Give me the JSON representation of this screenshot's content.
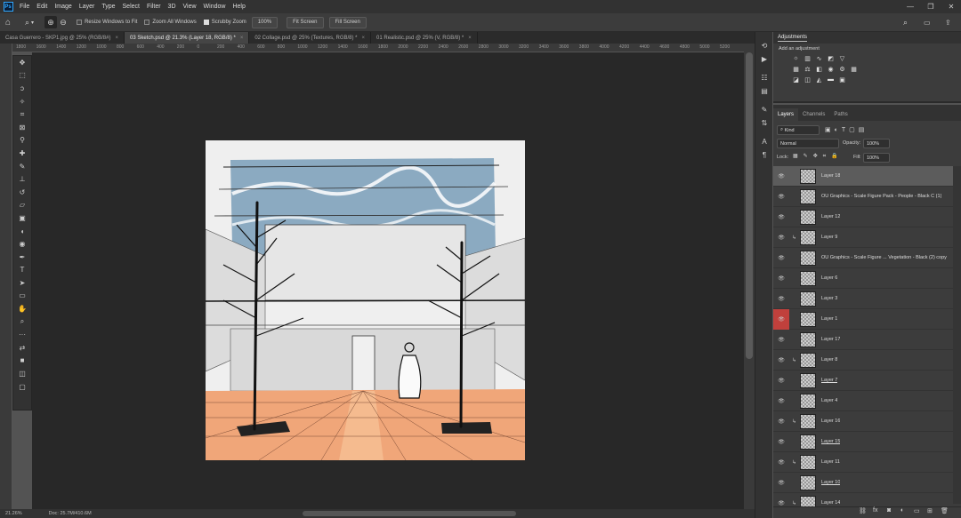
{
  "menubar": {
    "items": [
      "File",
      "Edit",
      "Image",
      "Layer",
      "Type",
      "Select",
      "Filter",
      "3D",
      "View",
      "Window",
      "Help"
    ],
    "logo": "Ps"
  },
  "optionsbar": {
    "resize_windows": "Resize Windows to Fit",
    "zoom_all": "Zoom All Windows",
    "scrubby": "Scrubby Zoom",
    "pct": "100%",
    "fit": "Fit Screen",
    "fill": "Fill Screen"
  },
  "tabs": [
    {
      "label": "Casa Guerrero - SKP1.jpg @ 25% (RGB/8#)"
    },
    {
      "label": "03 Sketch.psd @ 21.3% (Layer 18, RGB/8) *"
    },
    {
      "label": "02 Collage.psd @ 25% (Textures, RGB/8) *"
    },
    {
      "label": "01 Realistic.psd @ 25% (V, RGB/8) *"
    }
  ],
  "ruler_ticks": [
    "1800",
    "1600",
    "1400",
    "1200",
    "1000",
    "800",
    "600",
    "400",
    "200",
    "0",
    "200",
    "400",
    "600",
    "800",
    "1000",
    "1200",
    "1400",
    "1600",
    "1800",
    "2000",
    "2200",
    "2400",
    "2600",
    "2800",
    "3000",
    "3200",
    "3400",
    "3600",
    "3800",
    "4000",
    "4200",
    "4400",
    "4600",
    "4800",
    "5000",
    "5200"
  ],
  "status": {
    "zoom": "21.26%",
    "doc": "Doc: 25.7M/410.6M"
  },
  "adjustments": {
    "title": "Adjustments",
    "subtitle": "Add an adjustment"
  },
  "layers_panel": {
    "tabs": [
      "Layers",
      "Channels",
      "Paths"
    ],
    "kind": "Kind",
    "blend": "Normal",
    "opacity_label": "Opacity:",
    "opacity": "100%",
    "lock_label": "Lock:",
    "fill_label": "Fill:",
    "fill": "100%"
  },
  "layers": [
    {
      "name": "Layer 18",
      "selected": true
    },
    {
      "name": "OU Graphics - Scale Figure Pack - People - Black C (1)"
    },
    {
      "name": "Layer 12"
    },
    {
      "name": "Layer 9",
      "clipped": true
    },
    {
      "name": "OU Graphics - Scale Figure ... Vegetation - Black (2) copy"
    },
    {
      "name": "Layer 6"
    },
    {
      "name": "Layer 3"
    },
    {
      "name": "Layer 1",
      "red_eye": true
    },
    {
      "name": "Layer 17"
    },
    {
      "name": "Layer 8",
      "clipped": true
    },
    {
      "name": "Layer 7",
      "underline": true
    },
    {
      "name": "Layer 4"
    },
    {
      "name": "Layer 16",
      "clipped": true
    },
    {
      "name": "Layer 15",
      "underline": true
    },
    {
      "name": "Layer 11",
      "clipped": true
    },
    {
      "name": "Layer 10",
      "underline": true
    },
    {
      "name": "Layer 14",
      "clipped": true
    }
  ]
}
